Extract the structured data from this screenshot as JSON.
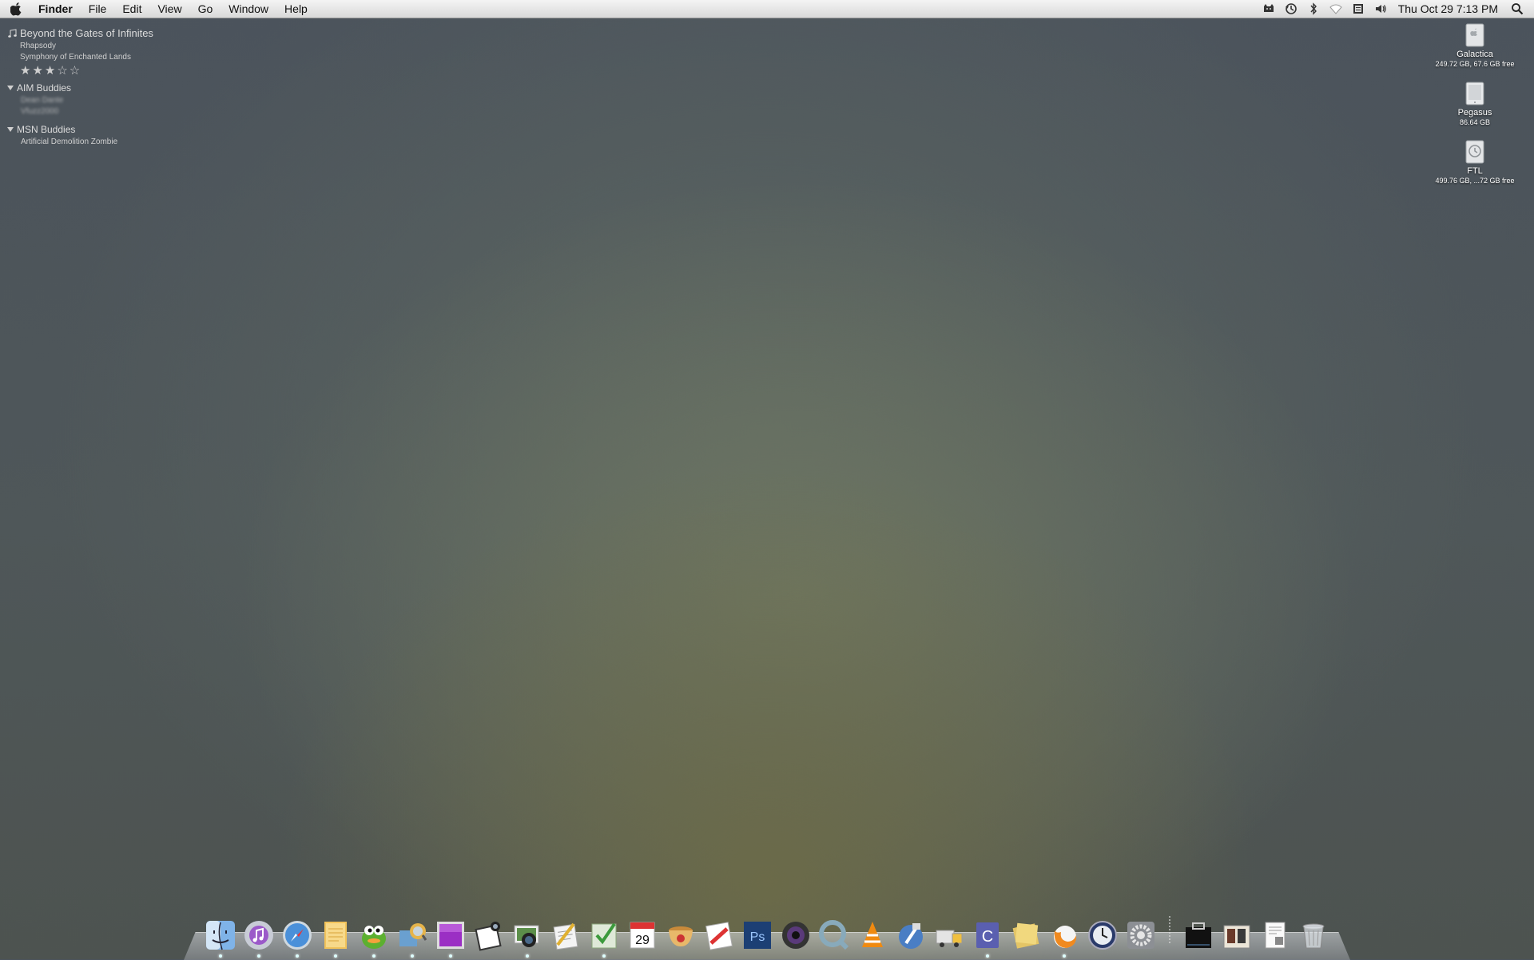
{
  "menubar": {
    "apple_icon": "apple-logo-icon",
    "app_name": "Finder",
    "menus": [
      "File",
      "Edit",
      "View",
      "Go",
      "Window",
      "Help"
    ],
    "status_icons": [
      "growl-icon",
      "time-machine-icon",
      "bluetooth-icon",
      "wifi-icon",
      "keyboard-input-icon",
      "volume-icon"
    ],
    "clock": "Thu Oct 29  7:13 PM",
    "spotlight_icon": "spotlight-search-icon"
  },
  "now_playing": {
    "note_icon": "music-note-icon",
    "title": "Beyond the Gates of Infinites",
    "artist": "Rhapsody",
    "album": "Symphony of Enchanted Lands",
    "stars": "★★★☆☆",
    "rating": 3
  },
  "buddy_groups": [
    {
      "name": "AIM Buddies",
      "buddies": [
        "Dean Dante",
        "Vfuzz2000"
      ]
    },
    {
      "name": "MSN Buddies",
      "buddies": [
        "Artificial Demolition Zombie"
      ]
    }
  ],
  "drives": [
    {
      "name": "Galactica",
      "info": "249.72 GB, 67.6 GB free",
      "icon": "hard-drive-icon"
    },
    {
      "name": "Pegasus",
      "info": "86.64 GB",
      "icon": "external-drive-icon"
    },
    {
      "name": "FTL",
      "info": "499.76 GB, ...72 GB free",
      "icon": "time-machine-drive-icon"
    }
  ],
  "dock": {
    "apps": [
      {
        "icon": "finder-icon",
        "running": true
      },
      {
        "icon": "itunes-icon",
        "running": true
      },
      {
        "icon": "safari-icon",
        "running": true
      },
      {
        "icon": "notes-icon",
        "running": true
      },
      {
        "icon": "adium-icon",
        "running": true
      },
      {
        "icon": "cyberduck-icon",
        "running": true
      },
      {
        "icon": "purple-app-icon",
        "running": true
      },
      {
        "icon": "preview-icon",
        "running": false
      },
      {
        "icon": "iphoto-icon",
        "running": true
      },
      {
        "icon": "textedit-icon",
        "running": false
      },
      {
        "icon": "things-icon",
        "running": true
      },
      {
        "icon": "ical-icon",
        "running": false
      },
      {
        "icon": "coffee-icon",
        "running": false
      },
      {
        "icon": "cssedit-icon",
        "running": false
      },
      {
        "icon": "photoshop-icon",
        "running": false
      },
      {
        "icon": "aperture-icon",
        "running": false
      },
      {
        "icon": "quicktime-icon",
        "running": false
      },
      {
        "icon": "vlc-icon",
        "running": false
      },
      {
        "icon": "xcode-icon",
        "running": false
      },
      {
        "icon": "transmit-icon",
        "running": false
      },
      {
        "icon": "coda-icon",
        "running": true
      },
      {
        "icon": "stickies-icon",
        "running": false
      },
      {
        "icon": "firefox-icon",
        "running": true
      },
      {
        "icon": "time-machine-icon",
        "running": false
      },
      {
        "icon": "system-preferences-icon",
        "running": false
      }
    ],
    "stacks": [
      {
        "icon": "applications-stack-icon"
      },
      {
        "icon": "documents-stack-icon"
      },
      {
        "icon": "downloads-stack-icon"
      },
      {
        "icon": "trash-icon"
      }
    ],
    "calendar_day": "29",
    "photoshop_label": "Ps"
  }
}
